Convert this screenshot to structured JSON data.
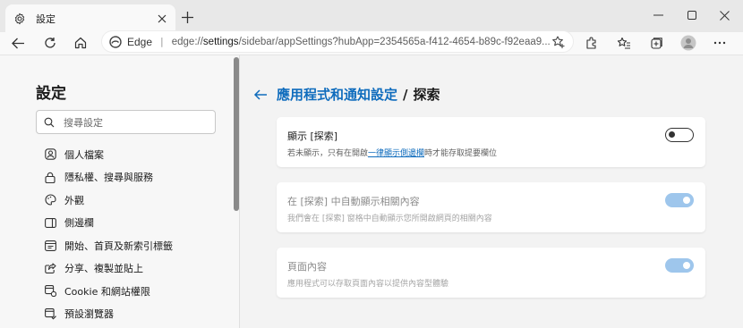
{
  "window": {
    "tab_title": "設定",
    "tab_icon": "gear-icon"
  },
  "toolbar": {
    "site_name": "Edge",
    "url_host": "edge://",
    "url_path_bold": "settings",
    "url_rest": "/sidebar/appSettings?hubApp=2354565a-f412-4654-b89c-f92eaa9..."
  },
  "sidebar": {
    "title": "設定",
    "search_placeholder": "搜尋設定",
    "items": [
      {
        "label": "個人檔案",
        "icon": "profile-icon"
      },
      {
        "label": "隱私權、搜尋與服務",
        "icon": "privacy-lock-icon"
      },
      {
        "label": "外觀",
        "icon": "appearance-icon"
      },
      {
        "label": "側邊欄",
        "icon": "sidebar-icon"
      },
      {
        "label": "開始、首頁及新索引標籤",
        "icon": "home-tab-icon"
      },
      {
        "label": "分享、複製並貼上",
        "icon": "share-icon"
      },
      {
        "label": "Cookie 和網站權限",
        "icon": "cookie-permissions-icon"
      },
      {
        "label": "預設瀏覽器",
        "icon": "default-browser-icon"
      }
    ]
  },
  "main": {
    "breadcrumb_parent": "應用程式和通知設定",
    "breadcrumb_sep": "/",
    "breadcrumb_current": "探索",
    "cards": [
      {
        "title": "顯示 [探索]",
        "desc_before": "若未顯示，只有在開啟",
        "desc_link": "一律顯示側邊欄",
        "desc_after": "時才能存取提要欄位",
        "toggle": "off"
      },
      {
        "title": "在 [探索] 中自動顯示相關內容",
        "desc": "我們會在 [探索] 窗格中自動顯示您所開啟網頁的相關內容",
        "toggle": "on"
      },
      {
        "title": "頁面內容",
        "desc": "應用程式可以存取頁面內容以提供內容型體驗",
        "toggle": "on"
      }
    ]
  },
  "colors": {
    "accent": "#0f6cbd",
    "toggle_on_disabled": "#9ec6ec"
  }
}
